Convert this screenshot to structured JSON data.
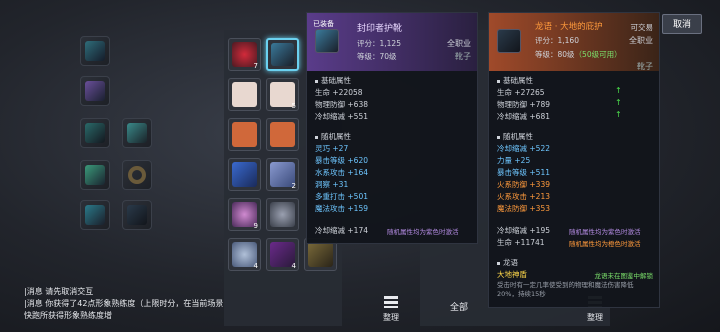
{
  "colors": {
    "purple_header": "#5a3c8a",
    "orange_header": "#a04a2a",
    "orange_text": "#ff9a3c",
    "blue_text": "#6ec6ff",
    "green_text": "#7be06b",
    "up_arrow": "#4ce04c"
  },
  "equipped_tip": {
    "tag": "已装备",
    "name": "封印者护靴",
    "score_label": "评分：",
    "score": "1,125",
    "class": "全职业",
    "level_label": "等级：",
    "level": "70级",
    "slot": "靴子",
    "base_title": "基础属性",
    "base": [
      {
        "k": "生命",
        "v": "+22058"
      },
      {
        "k": "物理防御",
        "v": "+638"
      },
      {
        "k": "冷却缩减",
        "v": "+551"
      }
    ],
    "random_title": "随机属性",
    "random": [
      {
        "k": "灵巧",
        "v": "+27",
        "c": "blue"
      },
      {
        "k": "暴击等级",
        "v": "+620",
        "c": "blue"
      },
      {
        "k": "水系攻击",
        "v": "+164",
        "c": "blue"
      },
      {
        "k": "洞察",
        "v": "+31",
        "c": "blue"
      },
      {
        "k": "多重打击",
        "v": "+501",
        "c": "blue"
      },
      {
        "k": "魔法攻击",
        "v": "+159",
        "c": "blue"
      }
    ],
    "extra": {
      "k": "冷却缩减",
      "v": "+174"
    },
    "note": "随机属性均为紫色时激活"
  },
  "new_tip": {
    "name": "龙语 · 大地的庇护",
    "tradable": "可交易",
    "score_label": "评分：",
    "score": "1,160",
    "class": "全职业",
    "level_label": "等级：",
    "level": "80级",
    "level_note": "（50级可用）",
    "slot": "靴子",
    "base_title": "基础属性",
    "base": [
      {
        "k": "生命",
        "v": "+27265"
      },
      {
        "k": "物理防御",
        "v": "+789"
      },
      {
        "k": "冷却缩减",
        "v": "+681"
      }
    ],
    "random_title": "随机属性",
    "random": [
      {
        "k": "冷却缩减",
        "v": "+522",
        "c": "blue"
      },
      {
        "k": "力量",
        "v": "+25",
        "c": "blue"
      },
      {
        "k": "暴击等级",
        "v": "+511",
        "c": "blue"
      },
      {
        "k": "火系防御",
        "v": "+339",
        "c": "orange"
      },
      {
        "k": "火系攻击",
        "v": "+213",
        "c": "orange"
      },
      {
        "k": "魔法防御",
        "v": "+353",
        "c": "orange"
      }
    ],
    "extra1": {
      "k": "冷却缩减",
      "v": "+195"
    },
    "note1": "随机属性均为紫色时激活",
    "extra2": {
      "k": "生命",
      "v": "+11741"
    },
    "note2": "随机属性均为橙色时激活",
    "dragon_title": "龙语",
    "dragon_name": "大地神盾",
    "dragon_hint": "龙语未在图鉴中解锁",
    "dragon_desc": "受击时有一定几率使受到的物理和魔法伤害降低20%，持续15秒"
  },
  "buttons": {
    "cancel": "取消",
    "sort_left": "整理",
    "all": "全部",
    "sort_right": "整理"
  },
  "bag_counts": {
    "c1": "7",
    "c2": "5",
    "c3": "2",
    "c4": "9",
    "c5": "4",
    "c6": "4"
  },
  "chat": {
    "line1_tag": "|消息",
    "line1": "请先取消交互",
    "line2_tag": "|消息",
    "line2": "你获得了42点形象熟练度（上限时分，在当前场景快跑所获得形象熟练度增"
  }
}
